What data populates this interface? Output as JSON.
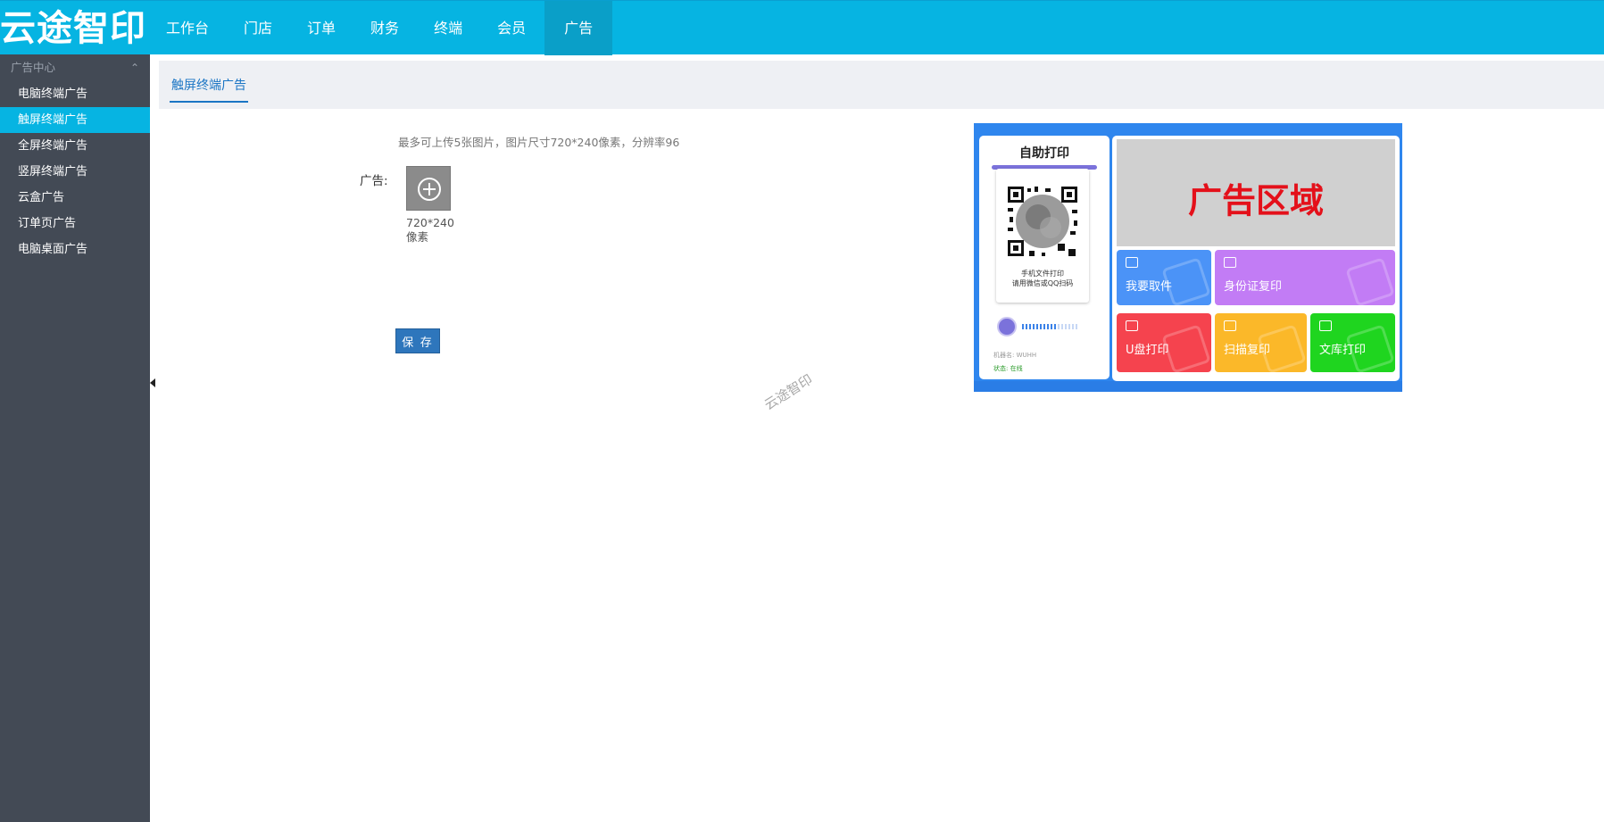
{
  "app": {
    "logo_text": "云途智印"
  },
  "nav": {
    "items": [
      {
        "label": "工作台"
      },
      {
        "label": "门店"
      },
      {
        "label": "订单"
      },
      {
        "label": "财务"
      },
      {
        "label": "终端"
      },
      {
        "label": "会员"
      },
      {
        "label": "广告"
      }
    ],
    "active_index": 6
  },
  "sidebar": {
    "section_title": "广告中心",
    "items": [
      {
        "label": "电脑终端广告"
      },
      {
        "label": "触屏终端广告"
      },
      {
        "label": "全屏终端广告"
      },
      {
        "label": "竖屏终端广告"
      },
      {
        "label": "云盒广告"
      },
      {
        "label": "订单页广告"
      },
      {
        "label": "电脑桌面广告"
      }
    ],
    "active_index": 1
  },
  "tabs": {
    "active_label": "触屏终端广告"
  },
  "form": {
    "hint": "最多可上传5张图片，图片尺寸720*240像素，分辨率96",
    "ad_label": "广告:",
    "upload_size_line1": "720*240",
    "upload_size_line2": "像素",
    "save_label": "保 存"
  },
  "watermark": "云途智印",
  "preview": {
    "title": "自助打印",
    "qr_caption_line1": "手机文件打印",
    "qr_caption_line2": "请用微信或QQ扫码",
    "machine_label": "机器名: WUHH",
    "status_label": "状态: 在线",
    "ad_area_text": "广告区域",
    "tiles": [
      {
        "label": "我要取件",
        "color": "#4b93f7"
      },
      {
        "label": "身份证复印",
        "color": "#c27cf5"
      },
      {
        "label": "U盘打印",
        "color": "#f5434e"
      },
      {
        "label": "扫描复印",
        "color": "#fbb829"
      },
      {
        "label": "文库打印",
        "color": "#1fd51f"
      }
    ]
  },
  "colors": {
    "topbar": "#06b4e2",
    "sidebar": "#434a55",
    "accent_blue": "#1a75c4",
    "save_button": "#2e76bc"
  }
}
